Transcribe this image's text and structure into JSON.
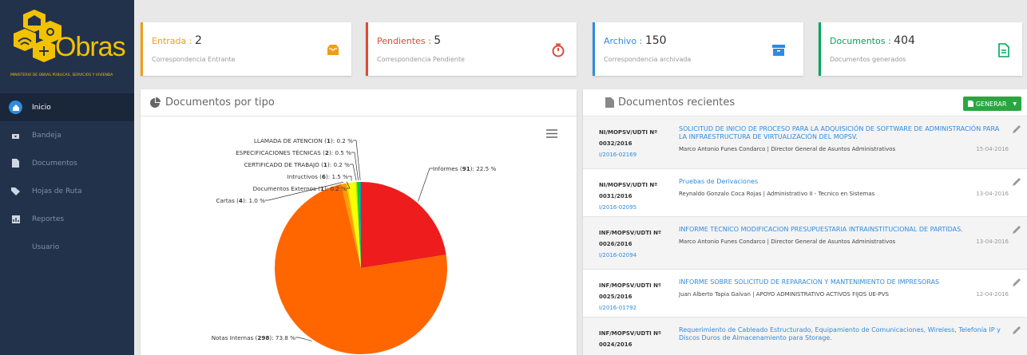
{
  "brand": {
    "name": "Obras",
    "subtitle": "MINISTERIO DE OBRAS PÚBLICAS, SERVICIOS Y VIVIENDA"
  },
  "sidebar": {
    "items": [
      {
        "label": "Inicio",
        "icon": "home-icon"
      },
      {
        "label": "Bandeja",
        "icon": "inbox-icon"
      },
      {
        "label": "Documentos",
        "icon": "document-icon"
      },
      {
        "label": "Hojas de Ruta",
        "icon": "tag-icon"
      },
      {
        "label": "Reportes",
        "icon": "chart-icon"
      },
      {
        "label": "Usuario",
        "icon": ""
      }
    ]
  },
  "stats": [
    {
      "label": "Entrada",
      "sep": " : ",
      "value": "2",
      "sub": "Correspondencia Entrante",
      "color": "#f39c12"
    },
    {
      "label": "Pendientes",
      "sep": " : ",
      "value": "5",
      "sub": "Correspondencia Pendiente",
      "color": "#dd4b39"
    },
    {
      "label": "Archivo",
      "sep": " : ",
      "value": "150",
      "sub": "Correspondencia archivada",
      "color": "#2f8be0"
    },
    {
      "label": "Documentos",
      "sep": " : ",
      "value": "404",
      "sub": "Documentos generados",
      "color": "#00a65a"
    }
  ],
  "chart_panel": {
    "title": "Documentos por tipo"
  },
  "chart_data": {
    "type": "pie",
    "slices": [
      {
        "name": "Informes",
        "count": 91,
        "pct": 22.5,
        "color": "#ee1c1c"
      },
      {
        "name": "Notas Internas",
        "count": 298,
        "pct": 73.8,
        "color": "#ff6600"
      },
      {
        "name": "Cartas",
        "count": 4,
        "pct": 1.0,
        "color": "#ff9e01"
      },
      {
        "name": "Documentos Externos",
        "count": 1,
        "pct": 0.2,
        "color": "#fcd202"
      },
      {
        "name": "Intructivos",
        "count": 6,
        "pct": 1.5,
        "color": "#f8ff01"
      },
      {
        "name": "CERTIFICADO DE TRABAJO",
        "count": 1,
        "pct": 0.2,
        "color": "#b0de09"
      },
      {
        "name": "ESPECIFICACIONES TÉCNICAS",
        "count": 2,
        "pct": 0.5,
        "color": "#04d215"
      },
      {
        "name": "LLAMADA DE ATENCION",
        "count": 1,
        "pct": 0.2,
        "color": "#0d8ecf"
      }
    ]
  },
  "recent_panel": {
    "title": "Documentos recientes",
    "button": "GENERAR"
  },
  "recent": [
    {
      "code1": "NI/MOPSV/UDTI Nº",
      "code2": "0032/2016",
      "ref": "I/2016-02169",
      "title": "SOLICITUD DE INICIO DE PROCESO PARA LA ADQUISICIÓN DE SOFTWARE DE ADMINISTRACIÓN PARA LA INFRAESTRUCTURA DE VIRTUALIZACIÓN DEL MOPSV.",
      "person": "Marco Antonio Funes Condarco | Director General de Asuntos Administrativos",
      "date": "15-04-2016"
    },
    {
      "code1": "NI/MOPSV/UDTI Nº",
      "code2": "0031/2016",
      "ref": "I/2016-02095",
      "title": "Pruebas de Derivaciones",
      "person": "Reynaldo Gonzalo Coca Rojas | Administrativo II - Tecnico en Sistemas",
      "date": "13-04-2016"
    },
    {
      "code1": "INF/MOPSV/UDTI Nº",
      "code2": "0026/2016",
      "ref": "I/2016-02094",
      "title": "INFORME TECNICO MODIFICACION PRESUPUESTARIA INTRAINSTITUCIONAL DE PARTIDAS.",
      "person": "Marco Antonio Funes Condarco | Director General de Asuntos Administrativos",
      "date": "13-04-2016"
    },
    {
      "code1": "INF/MOPSV/UDTI Nº",
      "code2": "0025/2016",
      "ref": "I/2016-01792",
      "title": "INFORME SOBRE SOLICITUD DE REPARACION Y MANTENIMIENTO DE IMPRESORAS",
      "person": "Juan Alberto Tapia Galvan | APOYO ADMINISTRATIVO ACTIVOS FIJOS UE-PVS",
      "date": "12-04-2016"
    },
    {
      "code1": "INF/MOPSV/UDTI Nº",
      "code2": "0024/2016",
      "ref": "",
      "title": "Requerimiento de Cableado Estructurado, Equipamiento de Comunicaciones, Wireless, Telefonía IP y Discos Duros de Almacenamiento para Storage.",
      "person": "",
      "date": ""
    }
  ]
}
